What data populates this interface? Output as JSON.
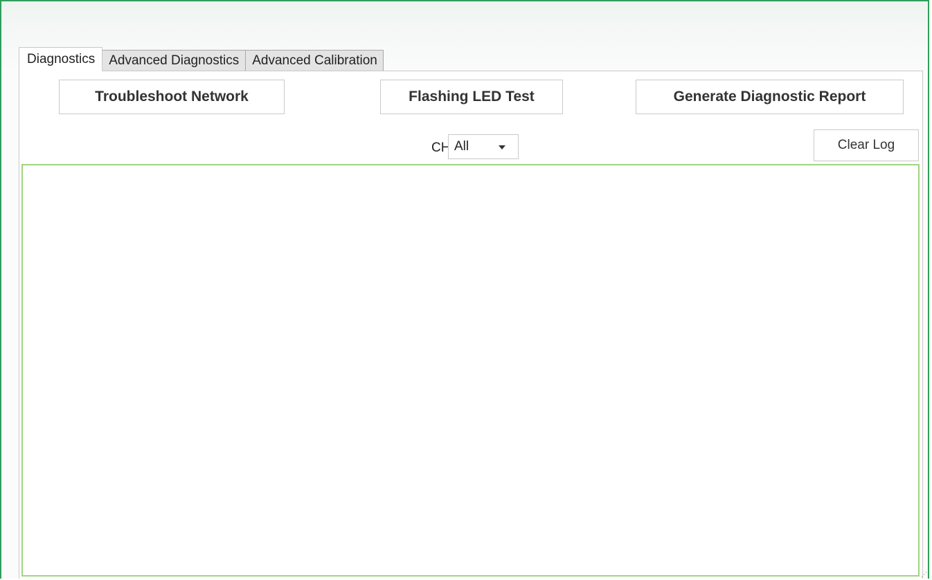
{
  "tabs": [
    {
      "label": "Diagnostics",
      "active": true
    },
    {
      "label": "Advanced Diagnostics",
      "active": false
    },
    {
      "label": "Advanced Calibration",
      "active": false
    }
  ],
  "actions": {
    "troubleshoot_label": "Troubleshoot Network",
    "flash_label": "Flashing LED Test",
    "report_label": "Generate Diagnostic Report"
  },
  "channel": {
    "label": "CH:",
    "selected": "All"
  },
  "log": {
    "clear_label": "Clear Log",
    "content": ""
  },
  "colors": {
    "window_border": "#2e9e5b",
    "log_border": "#9fd47f"
  }
}
